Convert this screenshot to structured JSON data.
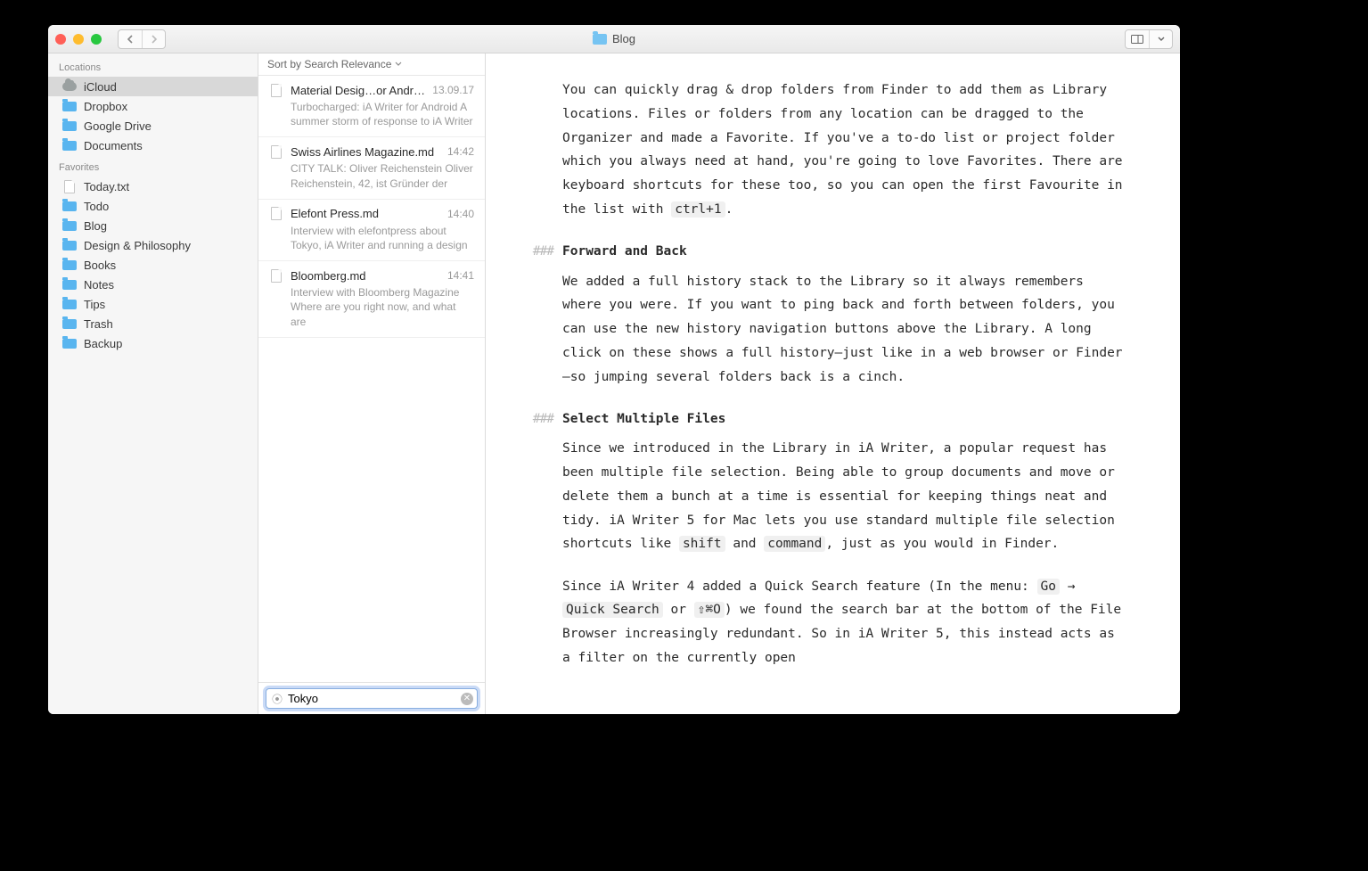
{
  "titlebar": {
    "breadcrumb": "Blog"
  },
  "sidebar": {
    "section_locations": "Locations",
    "section_favorites": "Favorites",
    "locations": [
      {
        "label": "iCloud",
        "icon": "cloud",
        "selected": true
      },
      {
        "label": "Dropbox",
        "icon": "folder"
      },
      {
        "label": "Google Drive",
        "icon": "folder"
      },
      {
        "label": "Documents",
        "icon": "folder"
      }
    ],
    "favorites": [
      {
        "label": "Today.txt",
        "icon": "file"
      },
      {
        "label": "Todo",
        "icon": "folder"
      },
      {
        "label": "Blog",
        "icon": "folder"
      },
      {
        "label": "Design & Philosophy",
        "icon": "folder"
      },
      {
        "label": "Books",
        "icon": "folder"
      },
      {
        "label": "Notes",
        "icon": "folder"
      },
      {
        "label": "Tips",
        "icon": "folder"
      },
      {
        "label": "Trash",
        "icon": "folder"
      },
      {
        "label": "Backup",
        "icon": "folder"
      }
    ]
  },
  "filelist": {
    "sort_label": "Sort by Search Relevance",
    "items": [
      {
        "name": "Material Desig…or Android.txt",
        "time": "13.09.17",
        "preview": "Turbocharged: iA Writer for Android A summer storm of response to iA Writer"
      },
      {
        "name": "Swiss Airlines Magazine.md",
        "time": "14:42",
        "preview": "CITY TALK: Oliver Reichenstein Oliver Reichenstein, 42, ist Gründer der"
      },
      {
        "name": "Elefont Press.md",
        "time": "14:40",
        "preview": "Interview with elefontpress about Tokyo, iA Writer and running a design"
      },
      {
        "name": "Bloomberg.md",
        "time": "14:41",
        "preview": "Interview with Bloomberg Magazine Where are you right now, and what are"
      }
    ]
  },
  "search": {
    "value": "Tokyo"
  },
  "editor": {
    "p1a": "You can quickly drag & drop folders from Finder to add them as Library locations. Files or folders from any location can be dragged to the Organizer and made a Favorite. If you've a to-do list or project folder which you always need at hand, you're going to love Favorites. There are keyboard shortcuts for these too, so you can open the first Favourite in the list with ",
    "p1code": "ctrl+1",
    "p1b": ".",
    "h1mark": "###",
    "h1": "Forward and Back",
    "p2": "We added a full history stack to the Library so it always remembers where you were. If you want to ping back and forth between folders, you can use the new history navigation buttons above the Library. A long click on these shows a full history—just like in a web browser or Finder—so jumping several folders back is a cinch.",
    "h2mark": "###",
    "h2": "Select Multiple Files",
    "p3a": "Since we introduced in the Library in iA Writer, a popular request has been multiple file selection. Being able to group documents and move or delete them a bunch at a time is essential for keeping things neat and tidy. iA Writer 5 for Mac lets you use standard multiple file selection shortcuts like ",
    "p3c1": "shift",
    "p3mid": " and ",
    "p3c2": "command",
    "p3b": ", just as you would in Finder.",
    "p4a": "Since iA Writer 4 added a Quick Search feature (In the menu: ",
    "p4c1": "Go",
    "p4arrow": " → ",
    "p4c2": "Quick Search",
    "p4or": " or ",
    "p4c3": "⇧⌘O",
    "p4b": ") we found the search bar at the bottom of the File Browser increasingly redundant. So in iA Writer 5, this instead acts as a filter on the currently open"
  }
}
